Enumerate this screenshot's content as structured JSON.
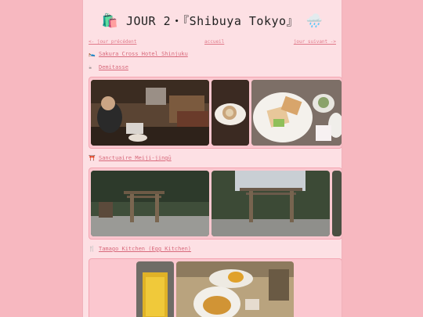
{
  "page": {
    "title_icon": "shopping-bags-icon",
    "title": "JOUR 2・『Shibuya Tokyo』",
    "weather_icon": "rain-cloud-icon"
  },
  "nav": {
    "prev": "<- jour précédent",
    "home": "accueil",
    "next": "jour suivant ->"
  },
  "sections": [
    {
      "icon": "bed-icon",
      "label": "Sakura Cross Hotel Shinjuku"
    },
    {
      "icon": "coffee-icon",
      "label": "Demitasse"
    },
    {
      "icon": "torii-gate-icon",
      "label": "Sanctuaire Meiji-jingū"
    },
    {
      "icon": "fork-knife-icon",
      "label": "Tamago Kitchen (Egg Kitchen)"
    }
  ],
  "colors": {
    "background": "#f7b8c0",
    "card": "#fde0e4",
    "link": "#d86a7c",
    "gallery_bg": "#fbc7cf"
  }
}
